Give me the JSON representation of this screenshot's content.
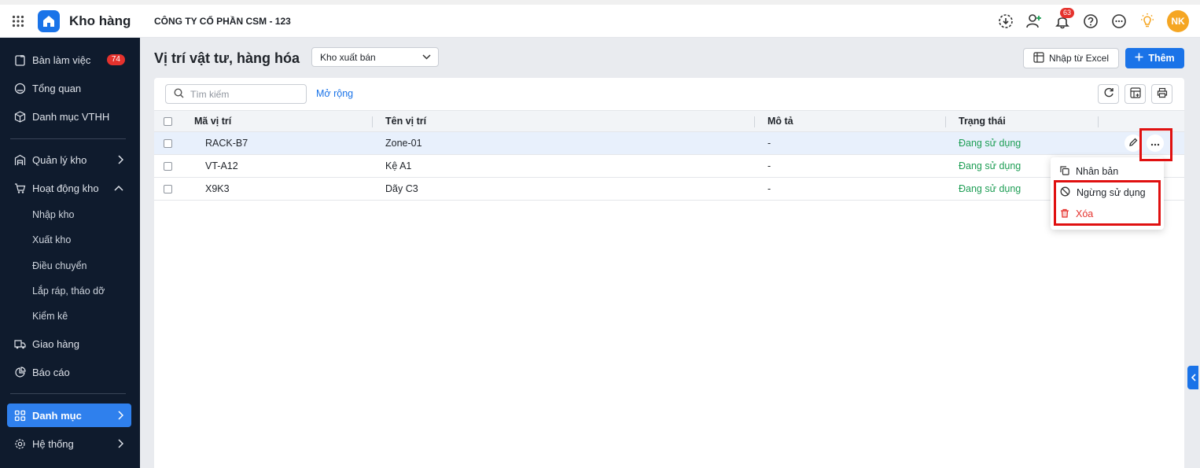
{
  "app": {
    "title": "Kho hàng",
    "company": "CÔNG TY CỔ PHẦN CSM - 123",
    "notification_count": "63",
    "avatar_initials": "NK",
    "accent_color": "#1a73e8"
  },
  "sidebar": {
    "items": [
      {
        "label": "Bàn làm việc",
        "badge": "74",
        "icon": "clipboard-icon"
      },
      {
        "label": "Tổng quan",
        "icon": "gauge-icon"
      },
      {
        "label": "Danh mục VTHH",
        "icon": "box-icon"
      },
      {
        "label": "Quản lý kho",
        "icon": "warehouse-icon"
      },
      {
        "label": "Hoạt động kho",
        "icon": "cart-icon"
      },
      {
        "label": "Giao hàng",
        "icon": "truck-icon"
      },
      {
        "label": "Báo cáo",
        "icon": "pie-chart-icon"
      },
      {
        "label": "Danh mục",
        "icon": "grid-icon",
        "active": true
      },
      {
        "label": "Hệ thống",
        "icon": "gear-icon"
      }
    ],
    "sub_items": [
      "Nhập kho",
      "Xuất kho",
      "Điều chuyển",
      "Lắp ráp, tháo dỡ",
      "Kiểm kê"
    ]
  },
  "page": {
    "title": "Vị trí vật tư, hàng hóa",
    "warehouse_select": "Kho xuất bán",
    "import_label": "Nhập từ Excel",
    "add_label": "Thêm",
    "search_placeholder": "Tìm kiếm",
    "expand_label": "Mở rộng"
  },
  "table": {
    "columns": [
      "Mã vị trí",
      "Tên vị trí",
      "Mô tả",
      "Trạng thái"
    ],
    "rows": [
      {
        "code": "RACK-B7",
        "name": "Zone-01",
        "desc": "-",
        "status": "Đang sử dụng"
      },
      {
        "code": "VT-A12",
        "name": "Kệ A1",
        "desc": "-",
        "status": "Đang sử dụng"
      },
      {
        "code": "X9K3",
        "name": "Dãy C3",
        "desc": "-",
        "status": "Đang sử dụng"
      }
    ]
  },
  "context_menu": {
    "items": [
      "Nhân bản",
      "Ngừng sử dụng",
      "Xóa"
    ]
  }
}
